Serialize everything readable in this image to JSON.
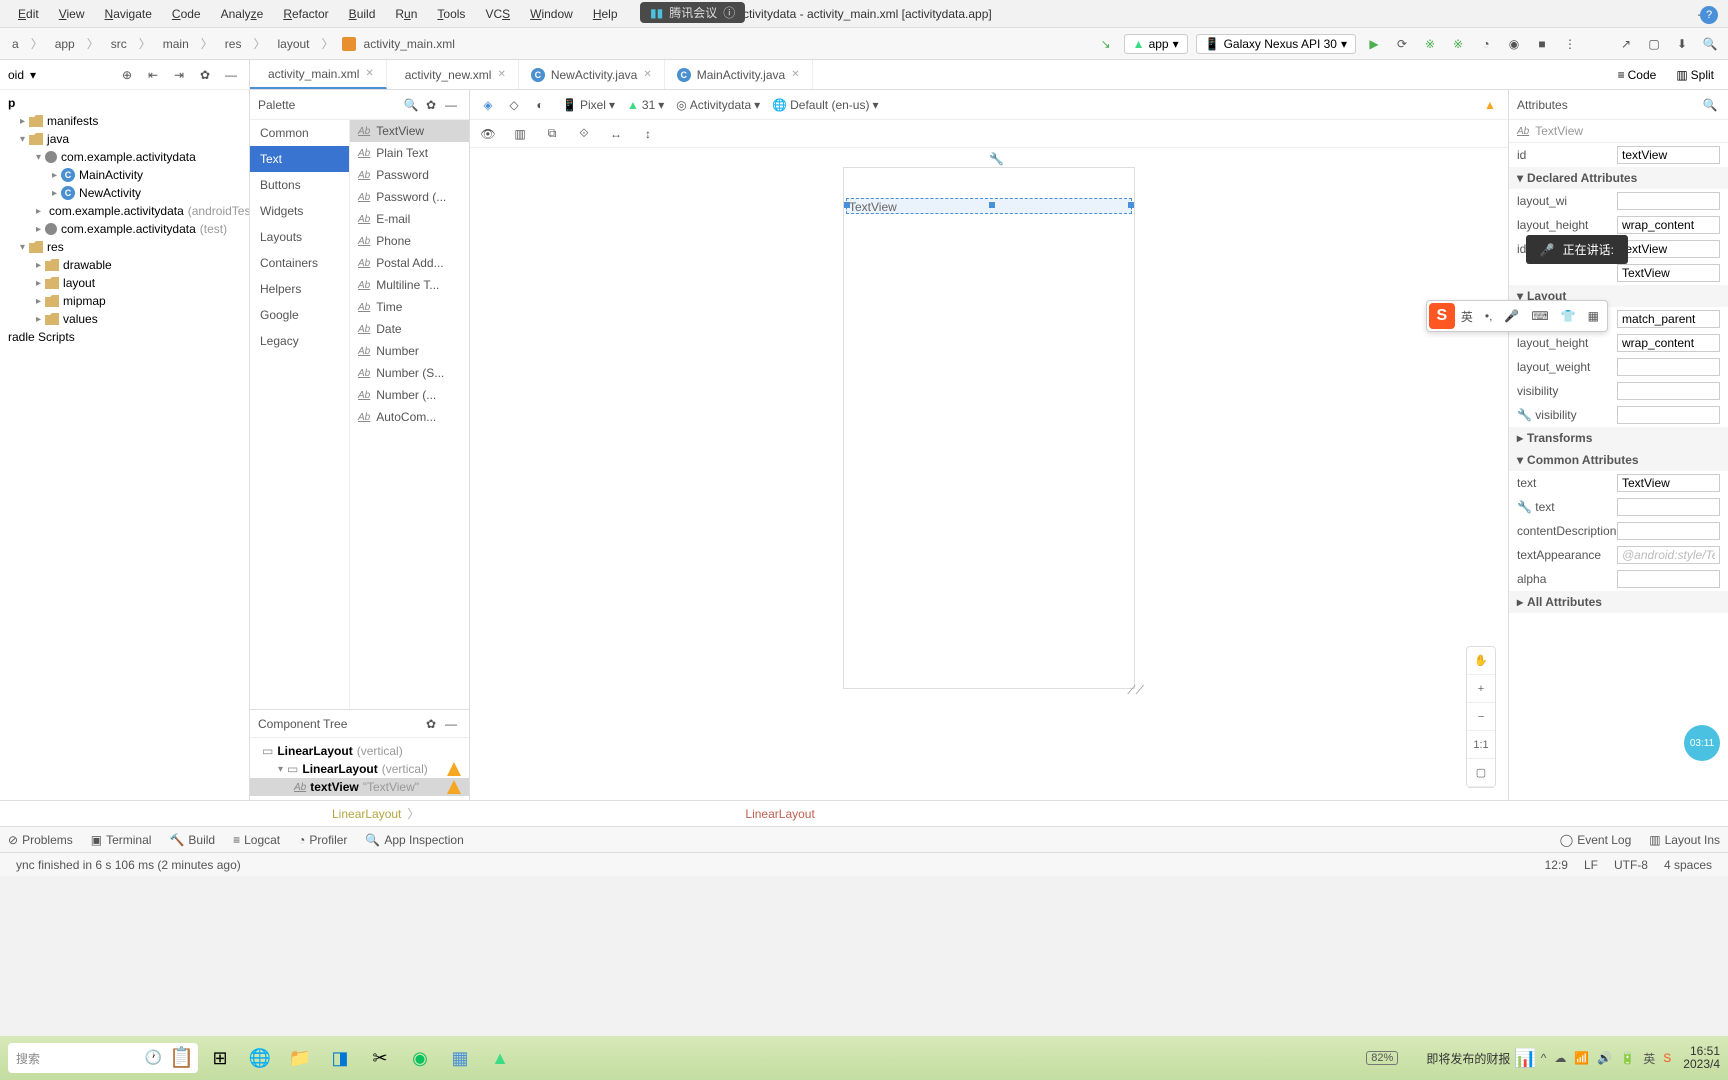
{
  "menubar": {
    "items": [
      "Edit",
      "View",
      "Navigate",
      "Code",
      "Analyze",
      "Refactor",
      "Build",
      "Run",
      "Tools",
      "VCS",
      "Window",
      "Help"
    ],
    "title": "activitydata - activity_main.xml [activitydata.app]"
  },
  "meeting_pill": "腾讯会议",
  "breadcrumb": [
    "a",
    "app",
    "src",
    "main",
    "res",
    "layout",
    "activity_main.xml"
  ],
  "toolbar": {
    "app_combo": "app",
    "device_combo": "Galaxy Nexus API 30"
  },
  "project": {
    "dropdown": "oid",
    "items": [
      {
        "label": "p",
        "depth": 1,
        "bold": true
      },
      {
        "label": "manifests",
        "depth": 2,
        "icon": "folder"
      },
      {
        "label": "java",
        "depth": 2,
        "icon": "folder",
        "exp": true
      },
      {
        "label": "com.example.activitydata",
        "depth": 3,
        "icon": "pkg",
        "exp": true
      },
      {
        "label": "MainActivity",
        "depth": 4,
        "icon": "class"
      },
      {
        "label": "NewActivity",
        "depth": 4,
        "icon": "class"
      },
      {
        "label": "com.example.activitydata",
        "hint": "(androidTest",
        "depth": 3,
        "icon": "pkg"
      },
      {
        "label": "com.example.activitydata",
        "hint": "(test)",
        "depth": 3,
        "icon": "pkg"
      },
      {
        "label": "res",
        "depth": 2,
        "icon": "folder",
        "exp": true
      },
      {
        "label": "drawable",
        "depth": 3,
        "icon": "folder"
      },
      {
        "label": "layout",
        "depth": 3,
        "icon": "folder"
      },
      {
        "label": "mipmap",
        "depth": 3,
        "icon": "folder"
      },
      {
        "label": "values",
        "depth": 3,
        "icon": "folder"
      },
      {
        "label": "radle Scripts",
        "depth": 1
      }
    ]
  },
  "tabs": [
    {
      "label": "activity_main.xml",
      "icon": "xml",
      "active": true
    },
    {
      "label": "activity_new.xml",
      "icon": "xml"
    },
    {
      "label": "NewActivity.java",
      "icon": "class"
    },
    {
      "label": "MainActivity.java",
      "icon": "class"
    }
  ],
  "view_switch": {
    "code": "Code",
    "split": "Split"
  },
  "palette": {
    "title": "Palette",
    "categories": [
      "Common",
      "Text",
      "Buttons",
      "Widgets",
      "Layouts",
      "Containers",
      "Helpers",
      "Google",
      "Legacy"
    ],
    "selected_cat": "Text",
    "items": [
      "TextView",
      "Plain Text",
      "Password",
      "Password (...",
      "E-mail",
      "Phone",
      "Postal Add...",
      "Multiline T...",
      "Time",
      "Date",
      "Number",
      "Number (S...",
      "Number (...",
      "AutoCom..."
    ],
    "selected_item": "TextView"
  },
  "component_tree": {
    "title": "Component Tree",
    "items": [
      {
        "label": "LinearLayout",
        "hint": "(vertical)",
        "depth": 1
      },
      {
        "label": "LinearLayout",
        "hint": "(vertical)",
        "depth": 2,
        "warn": true,
        "exp": true
      },
      {
        "label": "textView",
        "hint": "\"TextView\"",
        "depth": 3,
        "warn": true,
        "selected": true,
        "icon": "ab"
      }
    ]
  },
  "canvas_toolbar": {
    "device": "Pixel",
    "api": "31",
    "theme": "Activitydata",
    "locale": "Default (en-us)"
  },
  "device_widget_text": "TextView",
  "zoom": {
    "ratio": "1:1"
  },
  "attributes": {
    "title": "Attributes",
    "type": "TextView",
    "id_label": "id",
    "id_value": "textView",
    "sections": {
      "declared": "Declared Attributes",
      "layout": "Layout",
      "transforms": "Transforms",
      "common": "Common Attributes",
      "all": "All Attributes"
    },
    "declared": [
      {
        "k": "layout_wi",
        "v": ""
      },
      {
        "k": "layout_height",
        "v": "wrap_content"
      },
      {
        "k": "id",
        "v": "textView"
      },
      {
        "k": "",
        "v": "TextView"
      }
    ],
    "layout": [
      {
        "k": "layout_width",
        "v": "match_parent"
      },
      {
        "k": "layout_height",
        "v": "wrap_content"
      },
      {
        "k": "layout_weight",
        "v": ""
      },
      {
        "k": "visibility",
        "v": ""
      },
      {
        "k": "visibility",
        "v": "",
        "tool": true
      }
    ],
    "common": [
      {
        "k": "text",
        "v": "TextView"
      },
      {
        "k": "text",
        "v": "",
        "tool": true
      },
      {
        "k": "contentDescription",
        "v": ""
      },
      {
        "k": "textAppearance",
        "v": "",
        "placeholder": "@android:style/Te"
      },
      {
        "k": "alpha",
        "v": ""
      }
    ]
  },
  "speaking_overlay": "正在讲话:",
  "ime_lang": "英",
  "bottom_crumb": [
    "LinearLayout",
    "LinearLayout"
  ],
  "bottom_tabs": [
    "Problems",
    "Terminal",
    "Build",
    "Logcat",
    "Profiler",
    "App Inspection"
  ],
  "bottom_tabs_right": [
    "Event Log",
    "Layout Ins"
  ],
  "statusbar": {
    "msg": "ync finished in 6 s 106 ms (2 minutes ago)",
    "pos": "12:9",
    "encoding_lf": "LF",
    "encoding": "UTF-8",
    "spaces": "4 spaces"
  },
  "taskbar": {
    "search": "搜索",
    "battery": "82%",
    "news": "即将发布的财报",
    "time": "16:51",
    "date": "2023/4"
  },
  "timer": "03:11"
}
